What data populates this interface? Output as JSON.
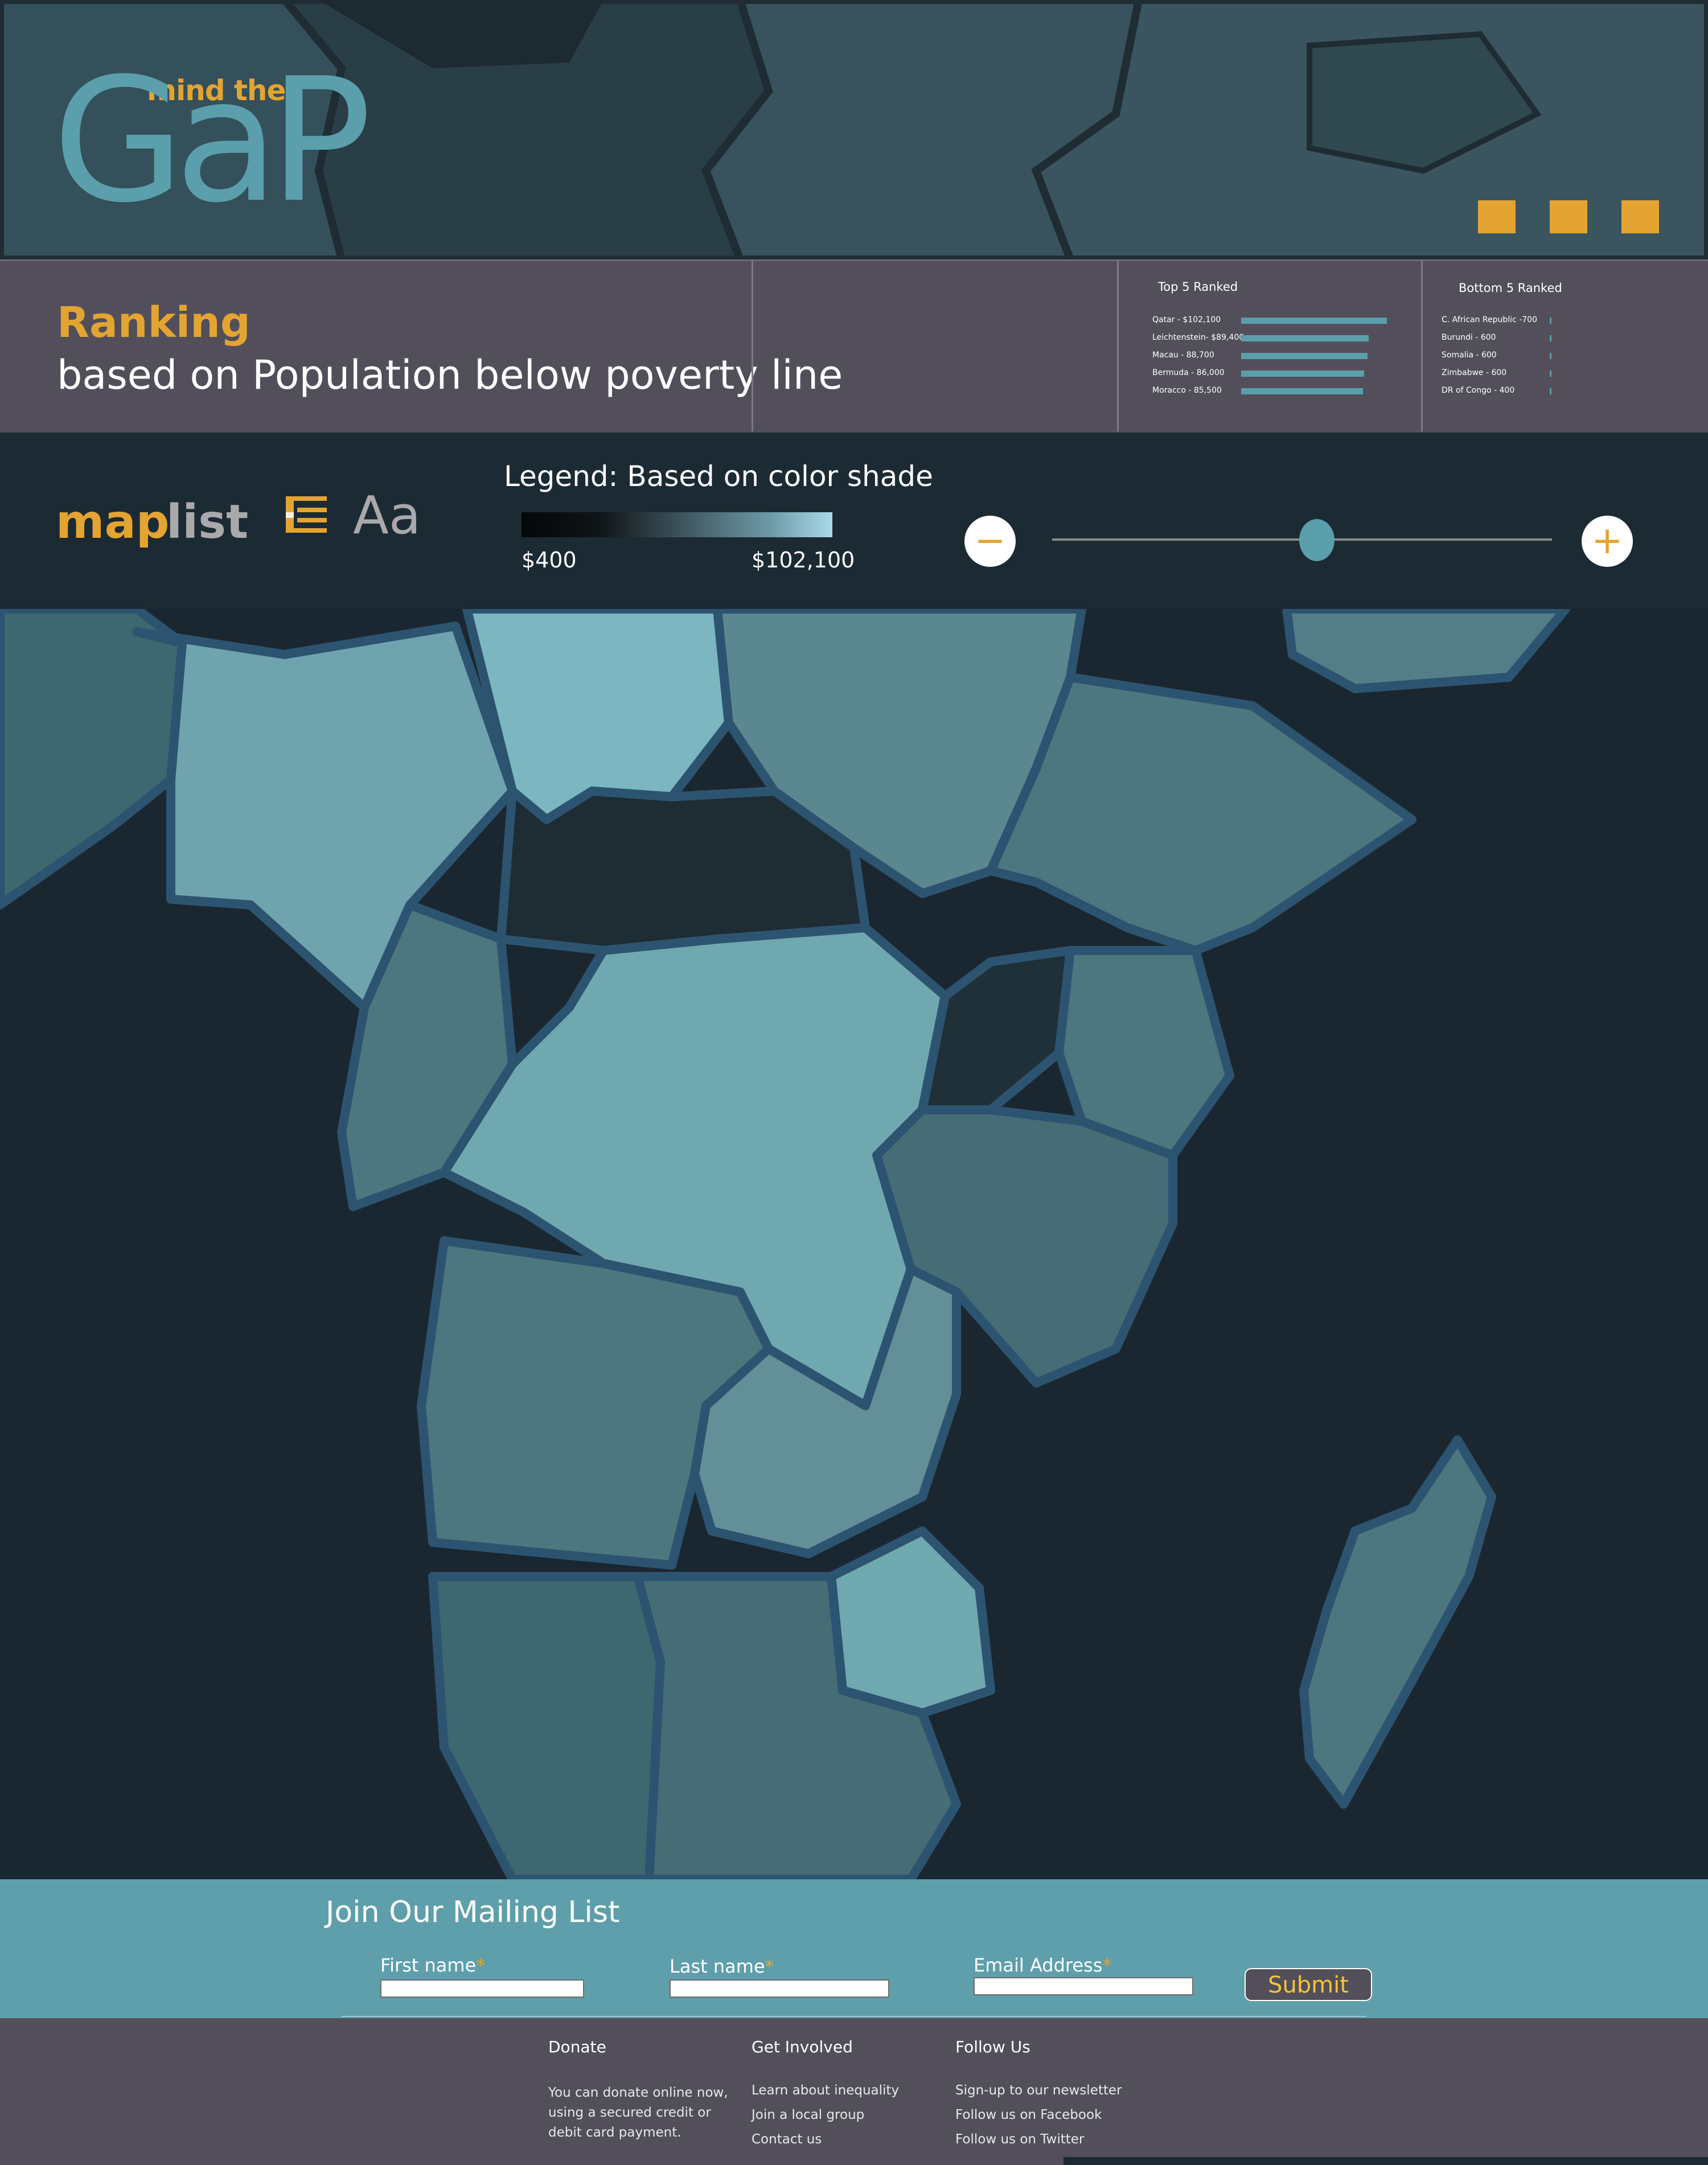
{
  "brand": {
    "logo_small": "mind the",
    "logo_big": "GaP"
  },
  "header": {
    "nav_squares": [
      "square-1",
      "square-2",
      "square-3"
    ]
  },
  "ranking": {
    "title": "Ranking",
    "subtitle": "based on Population below poverty line",
    "top5": {
      "title": "Top 5 Ranked",
      "rows": [
        {
          "label": "Qatar - $102,100",
          "value": 102100
        },
        {
          "label": "Leichtenstein- $89,400",
          "value": 89400
        },
        {
          "label": "Macau - 88,700",
          "value": 88700
        },
        {
          "label": "Bermuda - 86,000",
          "value": 86000
        },
        {
          "label": "Moracco - 85,500",
          "value": 85500
        }
      ]
    },
    "bottom5": {
      "title": "Bottom 5 Ranked",
      "rows": [
        {
          "label": "C. African Republic -700",
          "value": 700
        },
        {
          "label": "Burundi - 600",
          "value": 600
        },
        {
          "label": "Somalia - 600",
          "value": 600
        },
        {
          "label": "Zimbabwe - 600",
          "value": 600
        },
        {
          "label": "DR of Congo - 400",
          "value": 400
        }
      ]
    }
  },
  "controls": {
    "tab_map": "map",
    "tab_list": "list",
    "font_icon_label": "Aa",
    "legend_title": "Legend: Based on color shade",
    "legend_min": "$400",
    "legend_max": "$102,100",
    "zoom_out": "−",
    "zoom_in": "+",
    "zoom_level": 0.53
  },
  "colors": {
    "accent": "#e3a431",
    "teal": "#5a9fab",
    "panel": "#524f5a",
    "dark": "#1c2a33"
  },
  "mailing": {
    "title": "Join Our Mailing List",
    "first_name_label": "First name",
    "last_name_label": "Last name",
    "email_label": "Email Address",
    "required_mark": "*",
    "submit_label": "Submit"
  },
  "footer": {
    "donate": {
      "heading": "Donate",
      "text": "You can donate online now, using a secured credit or debit card payment."
    },
    "get_involved": {
      "heading": "Get Involved",
      "links": [
        "Learn about inequality",
        "Join a local group",
        "Contact us"
      ]
    },
    "follow_us": {
      "heading": "Follow Us",
      "links": [
        "Sign-up to our newsletter",
        "Follow us on Facebook",
        "Follow us on Twitter"
      ]
    }
  }
}
